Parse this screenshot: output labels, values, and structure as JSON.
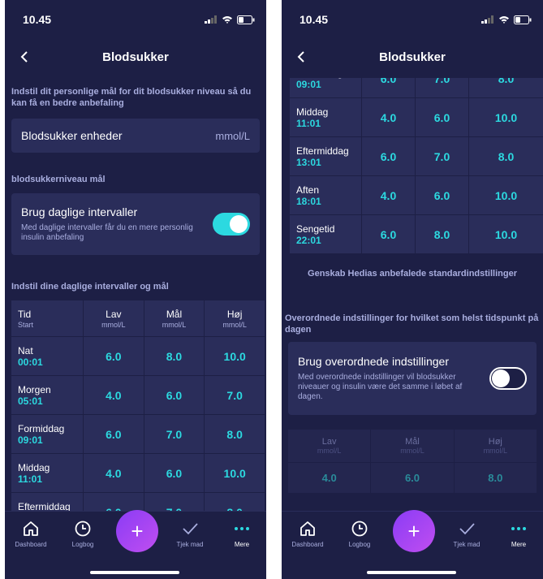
{
  "status": {
    "time": "10.45"
  },
  "header": {
    "title": "Blodsukker"
  },
  "left": {
    "intro": "Indstil dit personlige mål for dit blodsukker niveau så du kan få en bedre anbefaling",
    "unit": {
      "label": "Blodsukker enheder",
      "value": "mmol/L"
    },
    "goal_section": "blodsukkerniveau mål",
    "daily_toggle": {
      "title": "Brug daglige intervaller",
      "description": "Med daglige intervaller får du en mere personlig insulin anbefaling",
      "state": "on"
    },
    "intervals_section": "Indstil dine daglige intervaller og mål"
  },
  "table": {
    "headers": [
      {
        "main": "Tid",
        "sub": "Start"
      },
      {
        "main": "Lav",
        "sub": "mmol/L"
      },
      {
        "main": "Mål",
        "sub": "mmol/L"
      },
      {
        "main": "Høj",
        "sub": "mmol/L"
      }
    ],
    "rows": [
      {
        "name": "Nat",
        "time": "00:01",
        "low": "6.0",
        "target": "8.0",
        "high": "10.0"
      },
      {
        "name": "Morgen",
        "time": "05:01",
        "low": "4.0",
        "target": "6.0",
        "high": "7.0"
      },
      {
        "name": "Formiddag",
        "time": "09:01",
        "low": "6.0",
        "target": "7.0",
        "high": "8.0"
      },
      {
        "name": "Middag",
        "time": "11:01",
        "low": "4.0",
        "target": "6.0",
        "high": "10.0"
      },
      {
        "name": "Eftermiddag",
        "time": "13:01",
        "low": "6.0",
        "target": "7.0",
        "high": "8.0"
      },
      {
        "name": "Aften",
        "time": "18:01",
        "low": "4.0",
        "target": "6.0",
        "high": "10.0"
      },
      {
        "name": "Sengetid",
        "time": "22:01",
        "low": "6.0",
        "target": "8.0",
        "high": "10.0"
      }
    ]
  },
  "right": {
    "reset_label": "Genskab Hedias anbefalede standardindstillinger",
    "override_section": "Overordnede indstillinger for hvilket som helst tidspunkt på dagen",
    "override_toggle": {
      "title": "Brug overordnede indstillinger",
      "description": "Med overordnede indstillinger vil blodsukker niveauer og insulin være det samme i løbet af dagen.",
      "state": "off"
    },
    "override_values": [
      {
        "main": "Lav",
        "sub": "mmol/L",
        "value": "4.0"
      },
      {
        "main": "Mål",
        "sub": "mmol/L",
        "value": "6.0"
      },
      {
        "main": "Høj",
        "sub": "mmol/L",
        "value": "8.0"
      }
    ]
  },
  "tabs": [
    {
      "label": "Dashboard",
      "icon": "home-icon"
    },
    {
      "label": "Logbog",
      "icon": "clock-icon"
    },
    {
      "label": "Tjek mad",
      "icon": "check-icon"
    },
    {
      "label": "Mere",
      "icon": "more-icon",
      "active": true
    }
  ],
  "fab": {
    "symbol": "+"
  },
  "colors": {
    "background": "#1d1f45",
    "card": "#2a2d5a",
    "accent": "#2cd9e0",
    "fab": "#a045f2"
  }
}
